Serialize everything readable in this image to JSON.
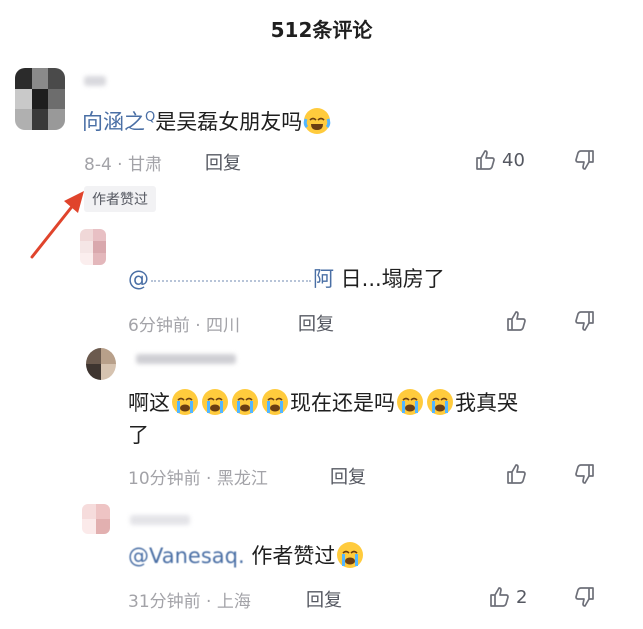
{
  "header": {
    "title": "512条评论"
  },
  "comments": [
    {
      "mention": "向涵之",
      "text": "是吴磊女朋友吗",
      "date": "8-4",
      "location": "甘肃",
      "reply_label": "回复",
      "likes": "40",
      "author_badge": "作者赞过",
      "avatar_colors": [
        "#2b2b2b",
        "#8a8a8a",
        "#4a4a4a",
        "#c9c9c9",
        "#1e1e1e",
        "#6d6d6d",
        "#b0b0b0",
        "#3a3a3a",
        "#999999"
      ]
    }
  ],
  "replies": [
    {
      "mention_visible": "@",
      "mention_tail": "阿",
      "text": " 日...塌房了",
      "time": "6分钟前",
      "location": "四川",
      "reply_label": "回复",
      "likes": "",
      "avatar_colors": [
        "#f0d8d8",
        "#e8c0c4",
        "#f5e6e6",
        "#d9a8ad",
        "#fbeeee",
        "#e3b7bb"
      ]
    },
    {
      "text_a": "啊这",
      "text_b": "现在还是吗",
      "text_c": "我真哭",
      "text_d": "了",
      "time": "10分钟前",
      "location": "黑龙江",
      "reply_label": "回复",
      "likes": "",
      "avatar_colors": [
        "#6b5a4e",
        "#b8a08a",
        "#3e3530",
        "#d6c3b0"
      ]
    },
    {
      "mention_visible": "@Vanesaq.",
      "text": " 作者赞过",
      "time": "31分钟前",
      "location": "上海",
      "reply_label": "回复",
      "likes": "2",
      "avatar_colors": [
        "#f6dcdc",
        "#eec4c4",
        "#fbeaea",
        "#e2b0b0"
      ]
    }
  ],
  "colors": {
    "accent_arrow": "#e0442c",
    "meta": "#a3a3a8",
    "mention": "#4a6fa5"
  }
}
